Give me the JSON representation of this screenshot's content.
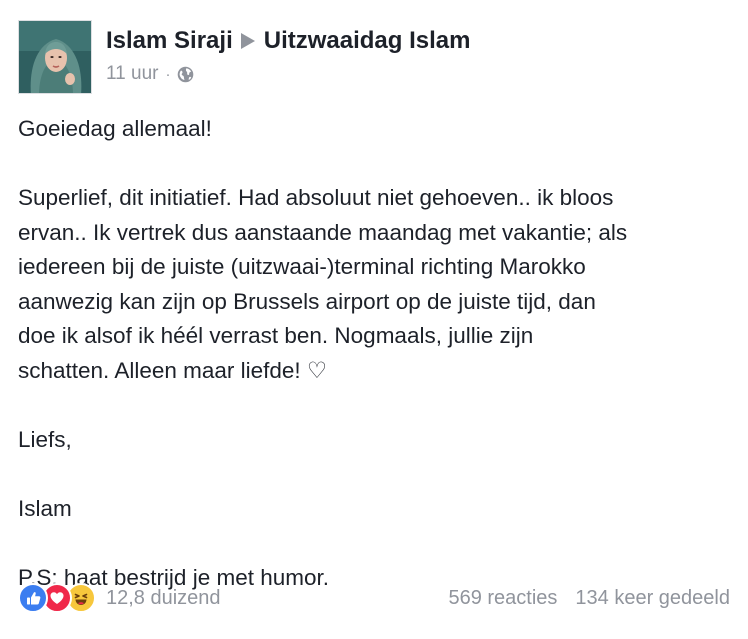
{
  "post": {
    "author": "Islam Siraji",
    "target": "Uitzwaaidag Islam",
    "time": "11 uur",
    "separator": "·",
    "privacy_icon": "globe-icon",
    "avatar_icon": "profile-photo",
    "lines": [
      "Goeiedag allemaal!",
      "",
      "Superlief, dit initiatief. Had absoluut niet gehoeven.. ik bloos",
      "ervan.. Ik vertrek dus aanstaande maandag met vakantie; als",
      "iedereen bij de juiste (uitzwaai-)terminal richting Marokko",
      "aanwezig kan zijn op Brussels airport op de juiste tijd, dan",
      "doe ik alsof ik héél verrast ben. Nogmaals, jullie zijn",
      "schatten. Alleen maar liefde! ♡",
      "",
      "Liefs,",
      "",
      "Islam",
      "",
      "P.S: haat bestrijd je met humor."
    ]
  },
  "footer": {
    "reaction_icons": [
      "like-icon",
      "love-icon",
      "haha-icon"
    ],
    "reaction_count": "12,8 duizend",
    "comments": "569 reacties",
    "shares": "134 keer gedeeld"
  },
  "colors": {
    "text": "#1d2129",
    "muted": "#90949c",
    "like": "#3b7df0",
    "love": "#f0284a",
    "haha": "#f7c73c"
  }
}
